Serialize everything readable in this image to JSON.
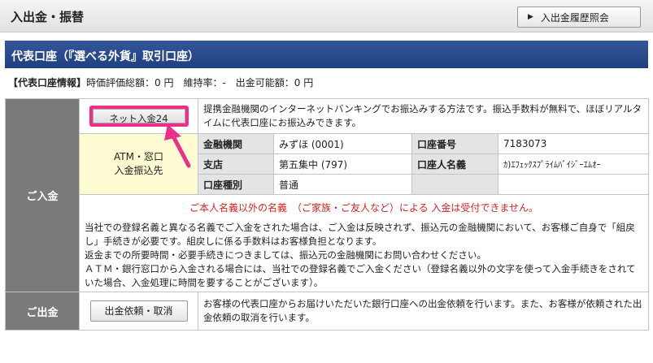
{
  "page": {
    "title": "入出金・振替",
    "history_button": "入出金履歴照会"
  },
  "section": {
    "title": "代表口座（『選べる外貨』取引口座）"
  },
  "account_info": {
    "label": "【代表口座情報】",
    "text": "時価評価総額：0 円　維持率：-　出金可能額：0 円"
  },
  "deposit": {
    "label": "ご入金",
    "net_button": "ネット入金24",
    "net_description": "提携金融機関のインターネットバンキングでお振込みする方法です。振込手数料が無料で、ほぼリアルタイムに代表口座にお振込みできます。",
    "atm_line1": "ATM・窓口",
    "atm_line2": "入金振込先",
    "bank_label": "金融機関",
    "bank_value": "みずほ (0001)",
    "account_no_label": "口座番号",
    "account_no_value": "7183073",
    "branch_label": "支店",
    "branch_value": "第五集中 (797)",
    "holder_label": "口座人名義",
    "holder_value": "ｶ)ｴﾌｪｯｸｽﾌﾟﾗｲﾑﾊﾞｲｼﾞｰｴﾑｵｰ",
    "type_label": "口座種別",
    "type_value": "普通",
    "warning": "ご本人名義以外の名義　（ご家族・ご友人など）による 入金は受付できません。",
    "notes": [
      "当社での登録名義と異なる名義でご入金をされた場合は、ご入金は反映されず、振込元の金融機関において、お客様ご自身で「組戻し」手続きが必要です。組戻しに係る手数料はお客様負担となります。",
      "返金までの所要時間・必要手続きにつきましては、振込元の金融機関にお問い合わせください。",
      "ＡＴＭ・銀行窓口から入金される場合には、当社での登録名義でご入金ください（登録名義以外の文字を使って入金手続きをされていた場合、入金処理に時間を要することがございます）。"
    ]
  },
  "withdraw": {
    "label": "ご出金",
    "button": "出金依頼・取消",
    "description": "お客様の代表口座からお届けいただいた銀行口座への出金依頼を行います。また、お客様が依頼された出金依頼の取消を行います。"
  },
  "colors": {
    "header_blue": "#26478a",
    "highlight_pink": "#ec2f8b",
    "warning_red": "#d02424",
    "atm_yellow": "#fdfbd2"
  }
}
